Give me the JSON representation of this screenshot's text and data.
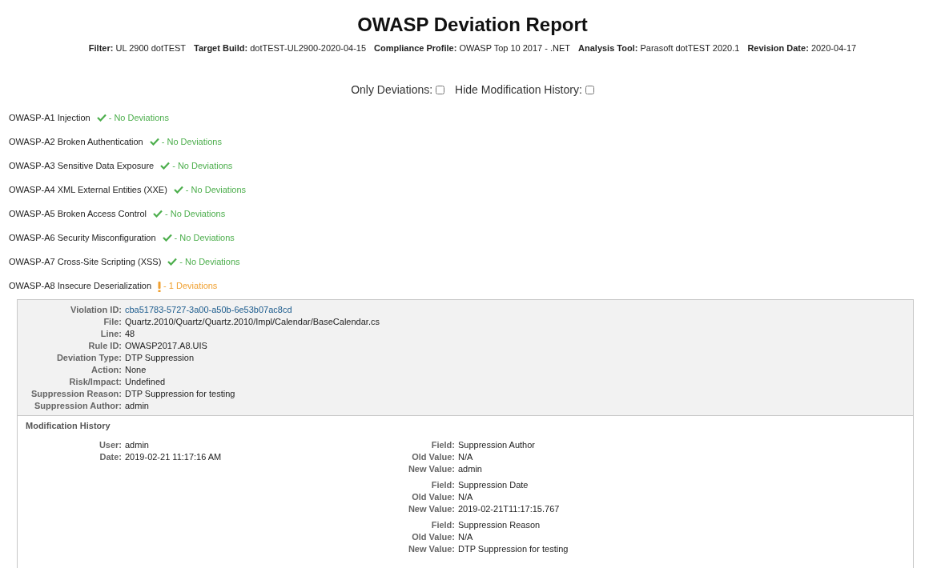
{
  "title": "OWASP Deviation Report",
  "meta": [
    {
      "label": "Filter:",
      "value": "UL 2900 dotTEST"
    },
    {
      "label": "Target Build:",
      "value": "dotTEST-UL2900-2020-04-15"
    },
    {
      "label": "Compliance Profile:",
      "value": "OWASP Top 10 2017 - .NET"
    },
    {
      "label": "Analysis Tool:",
      "value": "Parasoft dotTEST 2020.1"
    },
    {
      "label": "Revision Date:",
      "value": "2020-04-17"
    }
  ],
  "toggles": [
    {
      "label": "Only Deviations:",
      "checked": false
    },
    {
      "label": "Hide Modification History:",
      "checked": false
    }
  ],
  "categories": [
    {
      "name": "OWASP-A1 Injection",
      "kind": "ok",
      "status": "- No Deviations"
    },
    {
      "name": "OWASP-A2 Broken Authentication",
      "kind": "ok",
      "status": "- No Deviations"
    },
    {
      "name": "OWASP-A3 Sensitive Data Exposure",
      "kind": "ok",
      "status": "- No Deviations"
    },
    {
      "name": "OWASP-A4 XML External Entities (XXE)",
      "kind": "ok",
      "status": "- No Deviations"
    },
    {
      "name": "OWASP-A5 Broken Access Control",
      "kind": "ok",
      "status": "- No Deviations"
    },
    {
      "name": "OWASP-A6 Security Misconfiguration",
      "kind": "ok",
      "status": "- No Deviations"
    },
    {
      "name": "OWASP-A7 Cross-Site Scripting (XSS)",
      "kind": "ok",
      "status": "- No Deviations"
    },
    {
      "name": "OWASP-A8 Insecure Deserialization",
      "kind": "deviation",
      "status": "- 1 Deviations"
    }
  ],
  "violation": {
    "fields": [
      {
        "label": "Violation ID:",
        "value": "cba51783-5727-3a00-a50b-6e53b07ac8cd",
        "kind": "link"
      },
      {
        "label": "File:",
        "value": "Quartz.2010/Quartz/Quartz.2010/Impl/Calendar/BaseCalendar.cs",
        "kind": "text"
      },
      {
        "label": "Line:",
        "value": "48",
        "kind": "text"
      },
      {
        "label": "Rule ID:",
        "value": "OWASP2017.A8.UIS",
        "kind": "text"
      },
      {
        "label": "Deviation Type:",
        "value": "DTP Suppression",
        "kind": "text"
      },
      {
        "label": "Action:",
        "value": "None",
        "kind": "text"
      },
      {
        "label": "Risk/Impact:",
        "value": "Undefined",
        "kind": "text"
      },
      {
        "label": "Suppression Reason:",
        "value": "DTP Suppression for testing",
        "kind": "text"
      },
      {
        "label": "Suppression Author:",
        "value": "admin",
        "kind": "text"
      }
    ],
    "history": {
      "title": "Modification History",
      "entries": [
        {
          "info": [
            {
              "label": "User:",
              "value": "admin"
            },
            {
              "label": "Date:",
              "value": "2019-02-21 11:17:16 AM"
            }
          ],
          "changes": [
            [
              {
                "label": "Field:",
                "value": "Suppression Author"
              },
              {
                "label": "Old Value:",
                "value": "N/A"
              },
              {
                "label": "New Value:",
                "value": "admin"
              }
            ],
            [
              {
                "label": "Field:",
                "value": "Suppression Date"
              },
              {
                "label": "Old Value:",
                "value": "N/A"
              },
              {
                "label": "New Value:",
                "value": "2019-02-21T11:17:15.767"
              }
            ],
            [
              {
                "label": "Field:",
                "value": "Suppression Reason"
              },
              {
                "label": "Old Value:",
                "value": "N/A"
              },
              {
                "label": "New Value:",
                "value": "DTP Suppression for testing"
              }
            ]
          ]
        }
      ]
    }
  }
}
